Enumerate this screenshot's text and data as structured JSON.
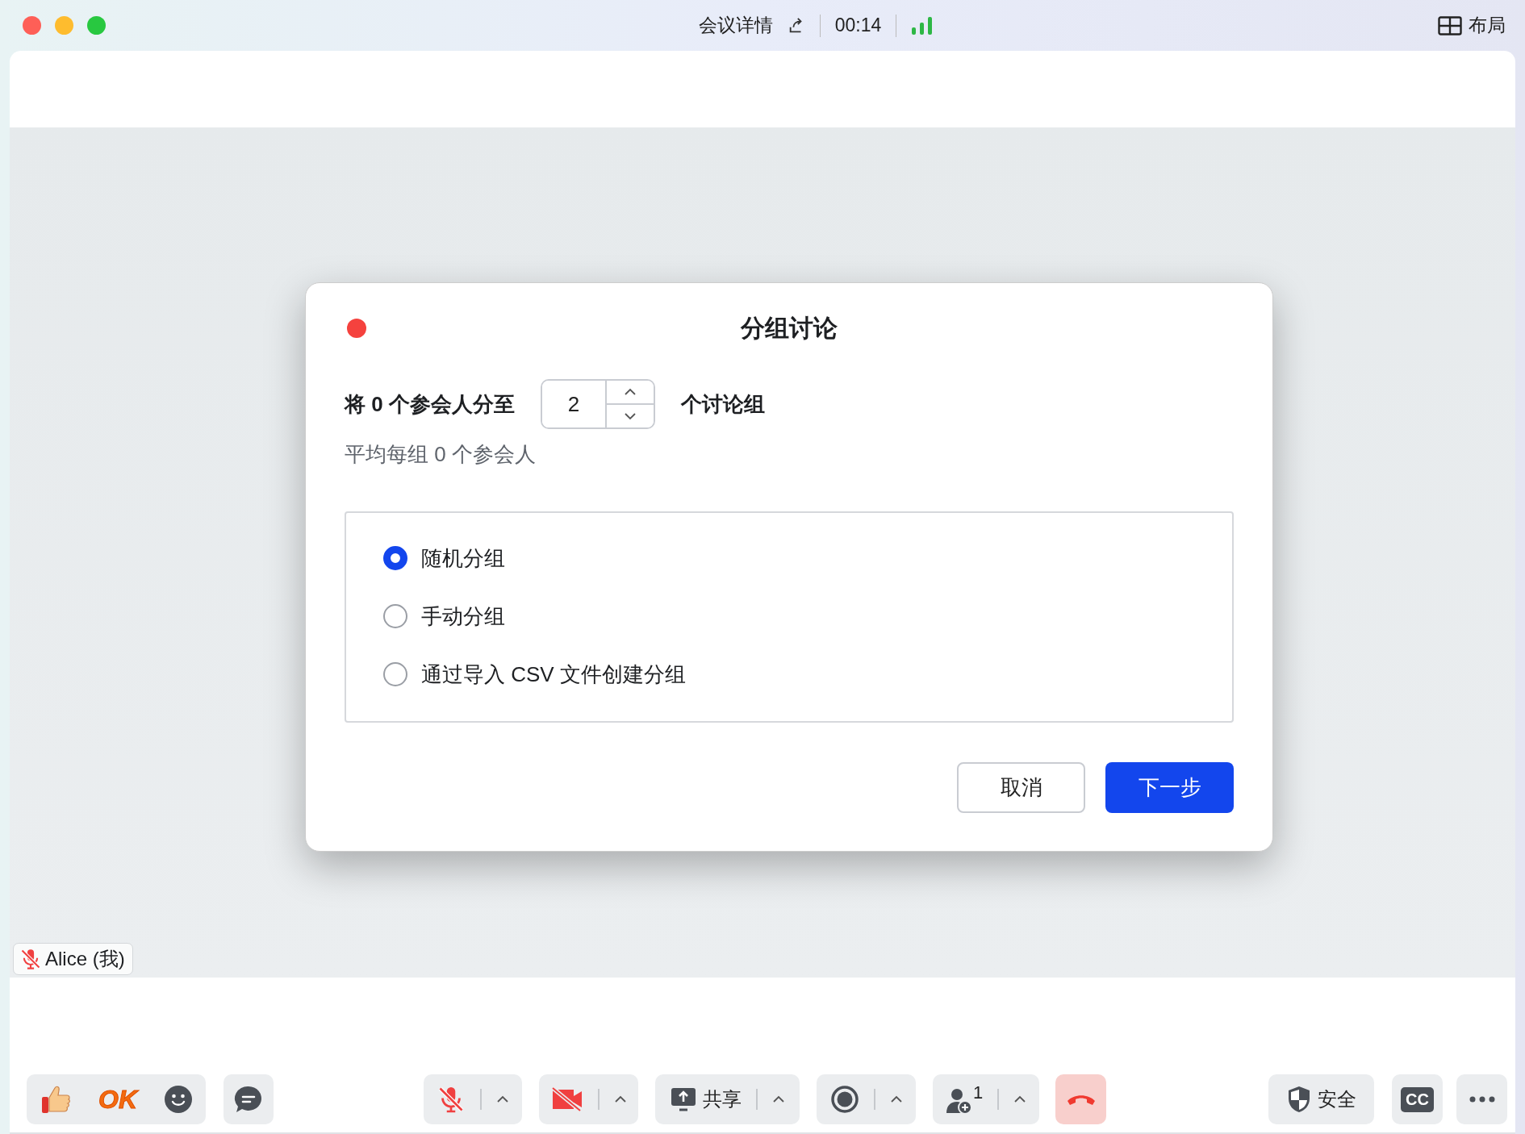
{
  "window": {
    "title": "会议详情",
    "timer": "00:14",
    "layout_label": "布局"
  },
  "dialog": {
    "title": "分组讨论",
    "prefix": "将 0 个参会人分至",
    "group_count": "2",
    "suffix": "个讨论组",
    "average": "平均每组 0 个参会人",
    "options": [
      {
        "label": "随机分组",
        "selected": true
      },
      {
        "label": "手动分组",
        "selected": false
      },
      {
        "label": "通过导入 CSV 文件创建分组",
        "selected": false
      }
    ],
    "buttons": [
      {
        "label": "取消",
        "kind": "secondary"
      },
      {
        "label": "下一步",
        "kind": "primary"
      }
    ]
  },
  "self_tile": {
    "name": "Alice (我)",
    "muted": true
  },
  "toolbar": {
    "reaction_text": "OK",
    "mic_muted": true,
    "video_off": true,
    "share_label": "共享",
    "participant_count": "1",
    "security_label": "安全",
    "captions_label": "CC"
  }
}
